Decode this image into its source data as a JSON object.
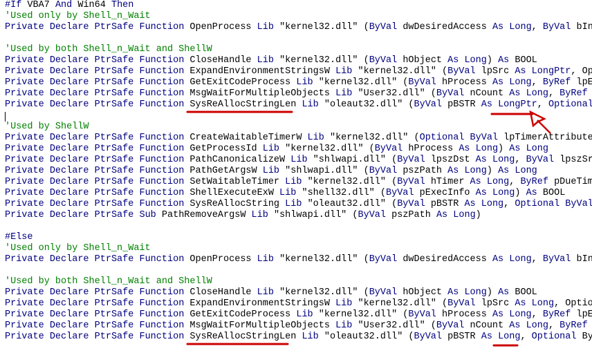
{
  "editor": {
    "lines": [
      "#If VBA7 And Win64 Then",
      "'Used only by Shell_n_Wait",
      "Private Declare PtrSafe Function OpenProcess Lib \"kernel32.dll\" (ByVal dwDesiredAccess As Long, ByVal bInhe",
      "",
      "'Used by both Shell_n_Wait and ShellW",
      "Private Declare PtrSafe Function CloseHandle Lib \"kernel32.dll\" (ByVal hObject As Long) As BOOL",
      "Private Declare PtrSafe Function ExpandEnvironmentStringsW Lib \"kernel32.dll\" (ByVal lpSrc As LongPtr, Opti",
      "Private Declare PtrSafe Function GetExitCodeProcess Lib \"kernel32.dll\" (ByVal hProcess As Long, ByRef lpExi",
      "Private Declare PtrSafe Function MsgWaitForMultipleObjects Lib \"User32.dll\" (ByVal nCount As Long, ByRef pH",
      "Private Declare PtrSafe Function SysReAllocStringLen Lib \"oleaut32.dll\" (ByVal pBSTR As LongPtr, Optional B",
      "",
      "'Used by ShellW",
      "Private Declare PtrSafe Function CreateWaitableTimerW Lib \"kernel32.dll\" (Optional ByVal lpTimerAttributes",
      "Private Declare PtrSafe Function GetProcessId Lib \"kernel32.dll\" (ByVal hProcess As Long) As Long",
      "Private Declare PtrSafe Function PathCanonicalizeW Lib \"shlwapi.dll\" (ByVal lpszDst As Long, ByVal lpszSrc",
      "Private Declare PtrSafe Function PathGetArgsW Lib \"shlwapi.dll\" (ByVal pszPath As Long) As Long",
      "Private Declare PtrSafe Function SetWaitableTimer Lib \"kernel32.dll\" (ByVal hTimer As Long, ByRef pDueTime",
      "Private Declare PtrSafe Function ShellExecuteExW Lib \"shell32.dll\" (ByVal pExecInfo As Long) As BOOL",
      "Private Declare PtrSafe Function SysReAllocString Lib \"oleaut32.dll\" (ByVal pBSTR As Long, Optional ByVal p",
      "Private Declare PtrSafe Sub PathRemoveArgsW Lib \"shlwapi.dll\" (ByVal pszPath As Long)",
      "",
      "#Else",
      "'Used only by Shell_n_Wait",
      "Private Declare PtrSafe Function OpenProcess Lib \"kernel32.dll\" (ByVal dwDesiredAccess As Long, ByVal bInhe",
      "",
      "'Used by both Shell_n_Wait and ShellW",
      "Private Declare PtrSafe Function CloseHandle Lib \"kernel32.dll\" (ByVal hObject As Long) As BOOL",
      "Private Declare PtrSafe Function ExpandEnvironmentStringsW Lib \"kernel32.dll\" (ByVal lpSrc As Long, Optiona",
      "Private Declare PtrSafe Function GetExitCodeProcess Lib \"kernel32.dll\" (ByVal hProcess As Long, ByRef lpExi",
      "Private Declare PtrSafe Function MsgWaitForMultipleObjects Lib \"User32.dll\" (ByVal nCount As Long, ByRef pH",
      "Private Declare PtrSafe Function SysReAllocStringLen Lib \"oleaut32.dll\" (ByVal pBSTR As Long, Optional ByVa"
    ],
    "keywords": [
      "#If",
      "And",
      "Then",
      "#Else",
      "Private",
      "Declare",
      "PtrSafe",
      "Function",
      "Sub",
      "Lib",
      "ByVal",
      "ByRef",
      "As",
      "Long",
      "LongPtr",
      "Optional"
    ],
    "colors": {
      "keyword": "#00007f",
      "comment": "#008000",
      "annotation": "#cc0000"
    }
  }
}
